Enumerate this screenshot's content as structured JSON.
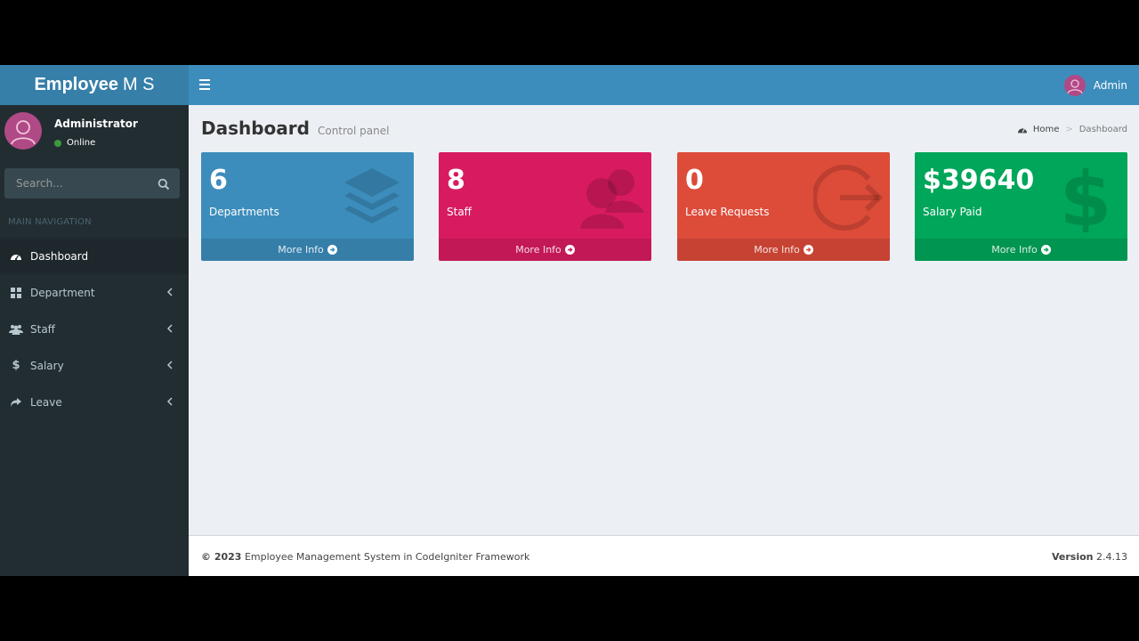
{
  "header": {
    "logo_bold": "Employee",
    "logo_rest": "M S",
    "user_name": "Admin"
  },
  "sidebar": {
    "user_name": "Administrator",
    "status": "Online",
    "search_placeholder": "Search...",
    "nav_header": "MAIN NAVIGATION",
    "items": [
      {
        "label": "Dashboard",
        "icon": "dashboard-icon"
      },
      {
        "label": "Department",
        "icon": "grid-icon"
      },
      {
        "label": "Staff",
        "icon": "users-icon"
      },
      {
        "label": "Salary",
        "icon": "dollar-icon"
      },
      {
        "label": "Leave",
        "icon": "share-icon"
      }
    ]
  },
  "content": {
    "title": "Dashboard",
    "subtitle": "Control panel",
    "breadcrumb": [
      "Home",
      "Dashboard"
    ]
  },
  "boxes": [
    {
      "value": "6",
      "label": "Departments",
      "more": "More Info",
      "color": "#3c8dbc",
      "icon": "layers-icon"
    },
    {
      "value": "8",
      "label": "Staff",
      "more": "More Info",
      "color": "#d81b60",
      "icon": "users-icon"
    },
    {
      "value": "0",
      "label": "Leave Requests",
      "more": "More Info",
      "color": "#dd4b39",
      "icon": "sign-out-icon"
    },
    {
      "value": "$39640",
      "label": "Salary Paid",
      "more": "More Info",
      "color": "#00a65a",
      "icon": "dollar-icon"
    }
  ],
  "footer": {
    "copyright": "© 2023",
    "text": "Employee Management System in CodeIgniter Framework",
    "version_label": "Version",
    "version": "2.4.13"
  }
}
